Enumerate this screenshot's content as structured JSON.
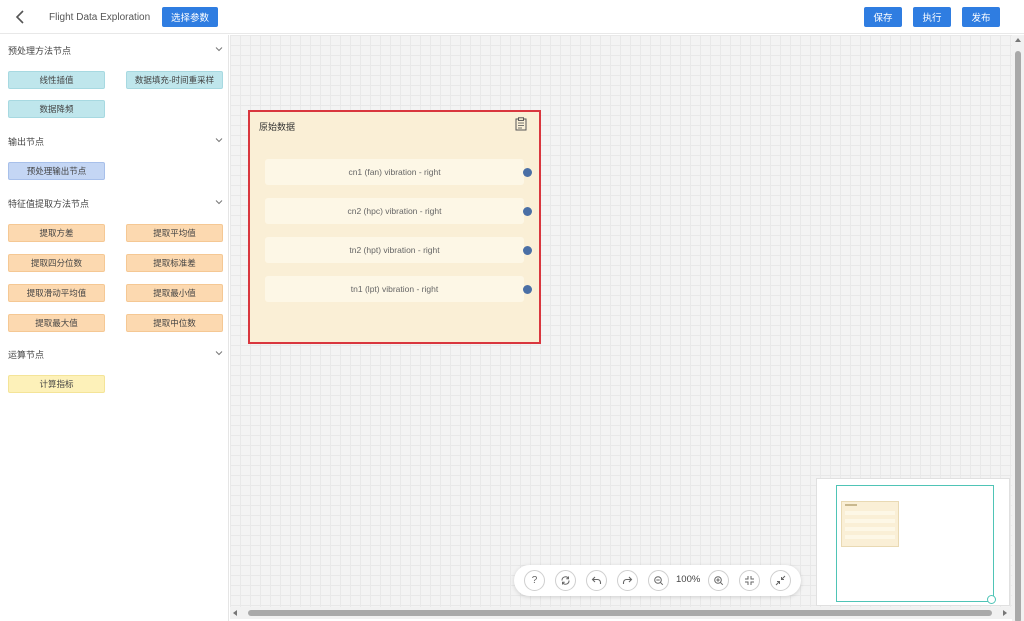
{
  "header": {
    "title": "Flight Data Exploration",
    "select_params": "选择参数",
    "save": "保存",
    "run": "执行",
    "publish": "发布"
  },
  "sidebar": {
    "groups": [
      {
        "title": "预处理方法节点",
        "items": [
          "线性插值",
          "数据填充-时间重采样",
          "数据降频"
        ]
      },
      {
        "title": "输出节点",
        "items": [
          "预处理输出节点"
        ]
      },
      {
        "title": "特征值提取方法节点",
        "items": [
          "提取方差",
          "提取平均值",
          "提取四分位数",
          "提取标准差",
          "提取滑动平均值",
          "提取最小值",
          "提取最大值",
          "提取中位数"
        ]
      },
      {
        "title": "运算节点",
        "items": [
          "计算指标"
        ]
      }
    ]
  },
  "canvas": {
    "node": {
      "title": "原始数据",
      "ports": [
        "cn1 (fan) vibration - right",
        "cn2 (hpc) vibration - right",
        "tn2 (hpt) vibration - right",
        "tn1 (lpt) vibration - right"
      ]
    }
  },
  "toolbar": {
    "help": "?",
    "zoom": "100%",
    "icons": [
      "help-icon",
      "refresh-icon",
      "undo-icon",
      "redo-icon",
      "zoom-out-icon",
      "zoom-in-icon",
      "fit-view-icon",
      "shrink-icon"
    ]
  },
  "colors": {
    "primary": "#2f7de1",
    "node_border_selected": "#d9363e",
    "port": "#4a6fa5",
    "minimap_view": "#4fc4b6"
  }
}
